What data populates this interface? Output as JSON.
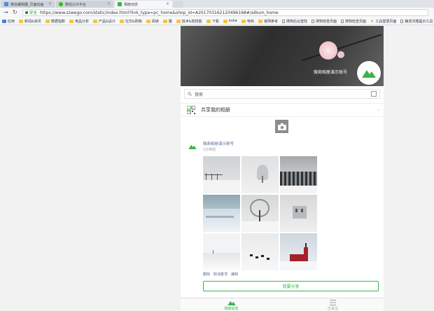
{
  "browser": {
    "tabs": [
      {
        "label": "微信编辑器_页面动画",
        "icon": "document-icon",
        "icon_color": "#4a90d9"
      },
      {
        "label": "微信公众平台",
        "icon": "wechat-icon",
        "icon_color": "#2dc100"
      },
      {
        "label": "相册动态",
        "icon": "album-icon",
        "icon_color": "#3cb34a"
      }
    ],
    "security_label": "安全",
    "url": "https://www.szwego.com/static/index.html?link_type=pc_home&shop_id=A201703162120496168#/album_home",
    "bookmarks": [
      {
        "label": "应用",
        "type": "apps"
      },
      {
        "label": "新闻&资讯",
        "type": "folder"
      },
      {
        "label": "数据指数",
        "type": "folder"
      },
      {
        "label": "竞品分析",
        "type": "folder"
      },
      {
        "label": "产品&设计",
        "type": "folder"
      },
      {
        "label": "社交&购物",
        "type": "folder"
      },
      {
        "label": "阅读",
        "type": "folder"
      },
      {
        "label": "猫",
        "type": "folder"
      },
      {
        "label": "技术&软技能",
        "type": "folder"
      },
      {
        "label": "下载",
        "type": "folder"
      },
      {
        "label": "indie",
        "type": "folder"
      },
      {
        "label": "电商",
        "type": "folder"
      },
      {
        "label": "官网参考",
        "type": "folder"
      },
      {
        "label": "搜狗后台登陆",
        "type": "page"
      },
      {
        "label": "搜狗检查页面",
        "type": "page"
      },
      {
        "label": "搜狗检查页面",
        "type": "page"
      },
      {
        "label": "工具登录页面",
        "type": "star"
      },
      {
        "label": "触发问题提示工具",
        "type": "page"
      }
    ]
  },
  "album": {
    "owner_name": "微商相册演示账号",
    "search_placeholder": "搜索",
    "share_album_label": "共享我的相册",
    "post": {
      "author": "微商相册演示账号",
      "time": "1分钟前",
      "photos": [
        "foggy-fence",
        "frosted-tree",
        "snowy-forest",
        "snow-field",
        "lone-tree",
        "snowy-ruin",
        "snow-slope",
        "horses-in-snow",
        "red-church"
      ],
      "actions": [
        "删除",
        "取消置顶",
        "编辑"
      ],
      "share_button": "我要分享"
    },
    "bottom_tabs": [
      {
        "label": "相册动态",
        "icon": "mountain-icon",
        "active": true
      },
      {
        "label": "已关注",
        "icon": "list-icon",
        "active": false
      }
    ],
    "accent_color": "#3cb34a"
  }
}
